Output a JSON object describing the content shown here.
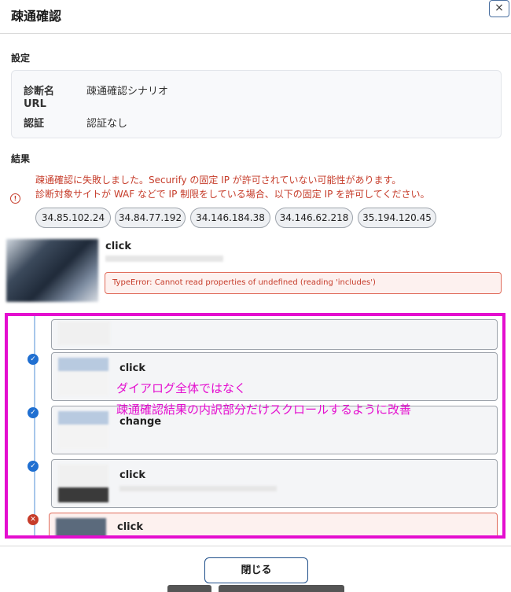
{
  "dialog": {
    "title": "疎通確認",
    "close_icon": "×"
  },
  "settings": {
    "section_label": "設定",
    "rows": [
      {
        "key": "診断名",
        "value": "疎通確認シナリオ"
      },
      {
        "key": "URL",
        "value": ""
      },
      {
        "key": "認証",
        "value": "認証なし"
      }
    ]
  },
  "results": {
    "section_label": "結果",
    "error_lines": [
      "疎通確認に失敗しました。Securify の固定 IP が許可されていない可能性があります。",
      "診断対象サイトが WAF などで IP 制限をしている場合、以下の固定 IP を許可してください。"
    ],
    "ips": [
      "34.85.102.24",
      "34.84.77.192",
      "34.146.184.38",
      "34.146.62.218",
      "35.194.120.45"
    ],
    "step": {
      "action": "click",
      "error": "TypeError: Cannot read properties of undefined (reading 'includes')"
    }
  },
  "timeline": {
    "steps": [
      {
        "action": "",
        "status": "done"
      },
      {
        "action": "click",
        "status": "done"
      },
      {
        "action": "change",
        "status": "done"
      },
      {
        "action": "click",
        "status": "done"
      },
      {
        "action": "click",
        "status": "error"
      }
    ]
  },
  "annotation": {
    "line1": "ダイアログ全体ではなく",
    "line2": "疎通確認結果の内訳部分だけスクロールするように改善",
    "color": "#e40ecf"
  },
  "footer": {
    "close_label": "閉じる"
  }
}
